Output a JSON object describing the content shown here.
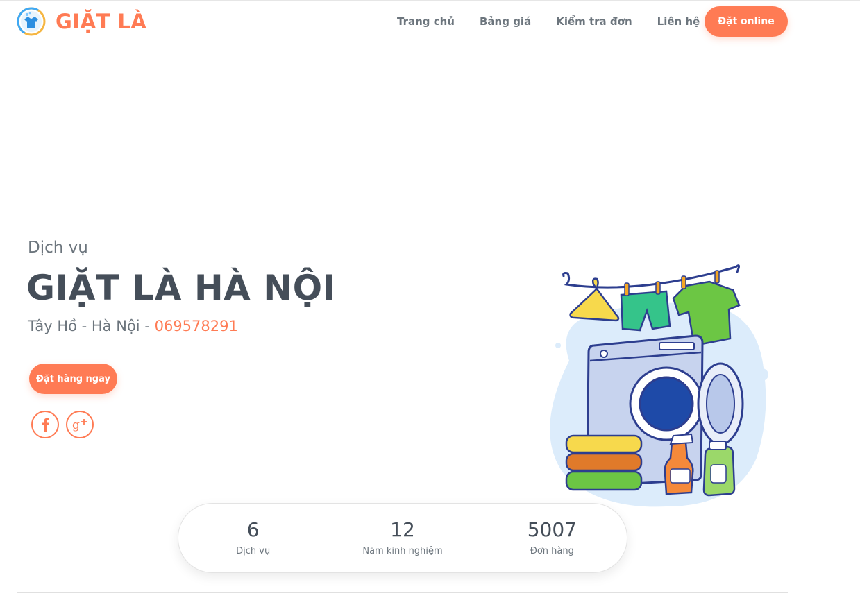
{
  "brand": {
    "name": "GIẶT LÀ",
    "color": "#ff7b54",
    "logo_icon": "washing-logo-icon"
  },
  "nav": {
    "items": [
      {
        "label": "Trang chủ"
      },
      {
        "label": "Bảng giá"
      },
      {
        "label": "Kiểm tra đơn"
      },
      {
        "label": "Liên hệ"
      }
    ],
    "cta_label": "Đặt online"
  },
  "hero": {
    "subtitle": "Dịch vụ",
    "title": "GIẶT LÀ HÀ NỘI",
    "location": "Tây Hồ - Hà Nội - ",
    "phone": "069578291",
    "order_button": "Đặt hàng ngay",
    "social": [
      {
        "icon": "facebook-icon"
      },
      {
        "icon": "google-plus-icon"
      }
    ],
    "illustration": "laundry-washing-machine-illustration"
  },
  "stats": [
    {
      "value": "6",
      "label": "Dịch vụ"
    },
    {
      "value": "12",
      "label": "Năm kinh nghiệm"
    },
    {
      "value": "5007",
      "label": "Đơn hàng"
    }
  ],
  "colors": {
    "accent": "#ff7b54",
    "heading": "#454e59",
    "text": "#6c757d"
  }
}
